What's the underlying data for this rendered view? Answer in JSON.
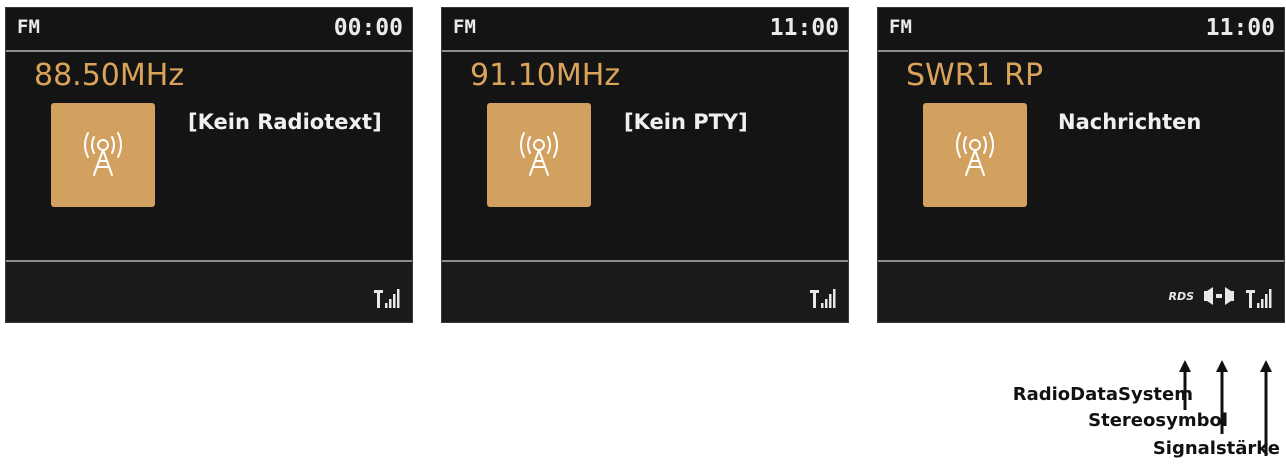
{
  "screens": [
    {
      "mode": "FM",
      "time": "00:00",
      "station": "88.50MHz",
      "radiotext": "[Kein Radiotext]",
      "show_rds": false,
      "show_stereo": false
    },
    {
      "mode": "FM",
      "time": "11:00",
      "station": "91.10MHz",
      "radiotext": "[Kein PTY]",
      "show_rds": false,
      "show_stereo": false
    },
    {
      "mode": "FM",
      "time": "11:00",
      "station": "SWR1 RP",
      "radiotext": "Nachrichten",
      "show_rds": true,
      "show_stereo": true
    }
  ],
  "status_icons": {
    "rds_label": "RDS",
    "stereo_icon": "stereo-icon",
    "signal_icon": "signal-strength-icon"
  },
  "legend": {
    "rds": "RadioDataSystem",
    "stereo": "Stereosymbol",
    "signal": "Signalstärke"
  },
  "colors": {
    "accent": "#d9a35a",
    "art_bg": "#d2a05f",
    "screen_bg": "#141414",
    "text": "#f0f0f0"
  }
}
